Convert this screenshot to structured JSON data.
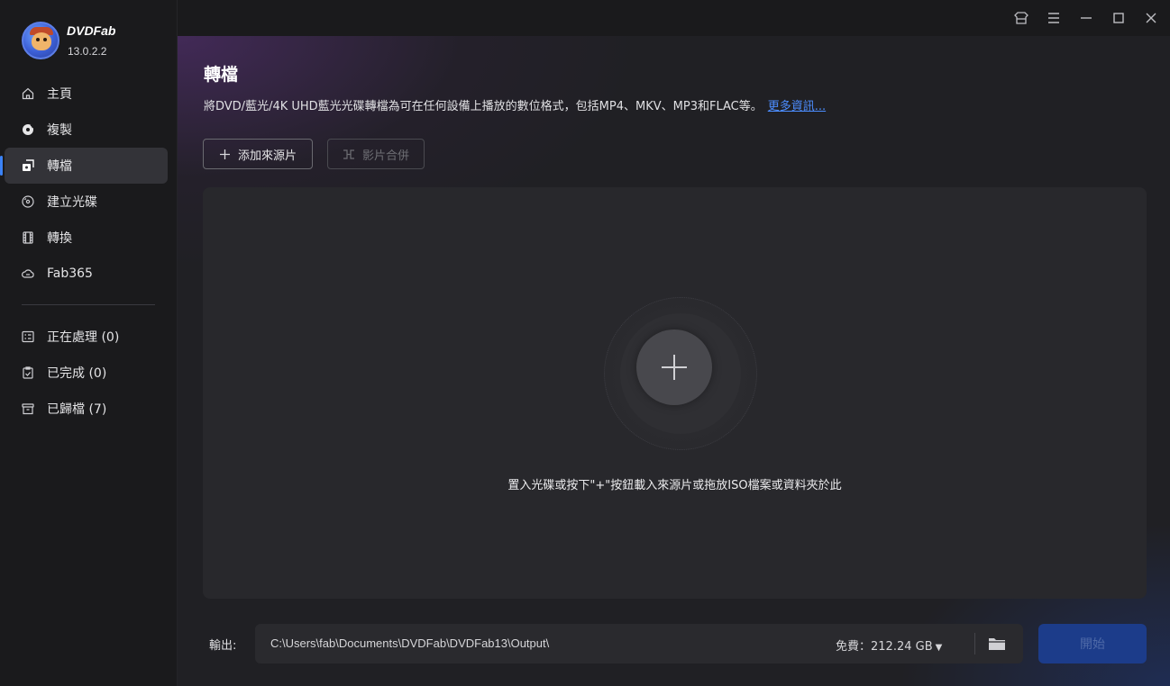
{
  "app": {
    "name": "DVDFab",
    "version": "13.0.2.2"
  },
  "sidebar": {
    "items": [
      {
        "label": "主頁",
        "icon": "home-icon"
      },
      {
        "label": "複製",
        "icon": "copy-disc-icon"
      },
      {
        "label": "轉檔",
        "icon": "ripper-icon",
        "active": true
      },
      {
        "label": "建立光碟",
        "icon": "create-disc-icon"
      },
      {
        "label": "轉換",
        "icon": "film-icon"
      },
      {
        "label": "Fab365",
        "icon": "cloud-icon"
      }
    ],
    "queue": [
      {
        "label": "正在處理 (0)",
        "icon": "processing-list-icon"
      },
      {
        "label": "已完成 (0)",
        "icon": "completed-clipboard-icon"
      },
      {
        "label": "已歸檔 (7)",
        "icon": "archive-box-icon"
      }
    ]
  },
  "titlebar": {
    "buttons": [
      "skin-icon",
      "menu-icon",
      "minimize-icon",
      "maximize-icon",
      "close-icon"
    ]
  },
  "main": {
    "title": "轉檔",
    "description": "將DVD/藍光/4K UHD藍光光碟轉檔為可在任何設備上播放的數位格式，包括MP4、MKV、MP3和FLAC等。",
    "more_link": "更多資訊...",
    "add_source_label": "添加來源片",
    "merge_label": "影片合併",
    "drop_hint": "置入光碟或按下\"+\"按鈕載入來源片或拖放ISO檔案或資料夾於此"
  },
  "footer": {
    "output_label": "輸出:",
    "output_path": "C:\\Users\\fab\\Documents\\DVDFab\\DVDFab13\\Output\\",
    "free_label": "免費：",
    "free_space": "212.24 GB",
    "start_label": "開始"
  },
  "colors": {
    "accent": "#3b82f6",
    "link": "#4c8dff",
    "start_button": "#1c3c8a"
  }
}
